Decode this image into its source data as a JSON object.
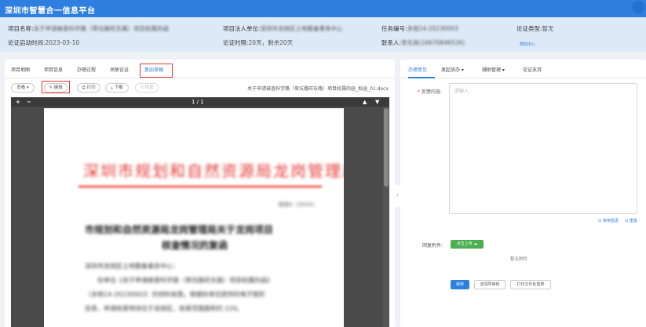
{
  "app": {
    "title": "深圳市智慧合一信息平台"
  },
  "project": {
    "name_label": "项目名称:",
    "name_value": "关于申请被查科学路（草坑路旺东路）项目权属的函",
    "owner_label": "项目法人单位:",
    "owner_value": "深圳市龙岗区土地整备事务中心",
    "task_label": "任务编号:",
    "task_value": "多规14-20230003",
    "type_label": "论证类型:",
    "type_value": "暂无",
    "start_label": "论证启动时间:",
    "start_value": "2023-03-10",
    "duration_label": "论证时限:",
    "duration_value": "20天，剩余20天",
    "contact_label": "联系人:",
    "contact_value": "李文高(16670846526)",
    "help_link": "帮助中心"
  },
  "left_tabs": [
    "项目地图",
    "项目信息",
    "办理过程",
    "关联论证",
    "复函草稿"
  ],
  "toolbar": {
    "view": "查看",
    "edit": "编辑",
    "print": "打印",
    "download": "下载",
    "restore": "恢复",
    "filename": "关于申请被查科学路（草坑路旺东路）项目权属的函_拟函_01.docx"
  },
  "viewer": {
    "page_indicator": "1 / 1",
    "plus": "+",
    "minus": "−"
  },
  "document": {
    "header": "深圳市规划和自然资源局龙岗管理局",
    "doc_no": "深规X〔202X〕",
    "title_line1": "市规划和自然资源局龙岗管理局关于龙岗项目",
    "title_line2": "核查情况的复函",
    "salutation": "深圳市龙岗区土地整备事务中心：",
    "body1": "你单位《关于申请被查科学路（草坑路旺东路）项目权属的函》",
    "body2": "（多规14-20230003）的材料收悉。根据你单位提供的电子图形",
    "body3": "信息，申请核查地块位于龙岗区，核查范围面积约 220。"
  },
  "right_tabs": [
    "办理意见",
    "发起协办",
    "辅助管理",
    "论证支持"
  ],
  "opinion": {
    "label": "反馈内容:",
    "placeholder": "请输入",
    "common_phrases": "常用短语",
    "reset": "重置"
  },
  "attachment": {
    "label": "回复附件:",
    "upload": "点击上传",
    "empty": "暂无附件"
  },
  "actions": {
    "save": "保存",
    "chop": "送领导审核",
    "print_process": "打印文件处理表"
  }
}
